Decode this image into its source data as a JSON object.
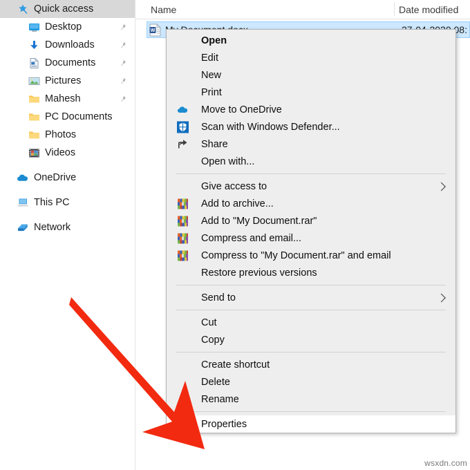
{
  "sidebar": {
    "items": [
      {
        "label": "Quick access",
        "icon": "star-pin-icon",
        "indent": 0,
        "selected": true,
        "pinned": false
      },
      {
        "label": "Desktop",
        "icon": "desktop-icon",
        "indent": 1,
        "selected": false,
        "pinned": true
      },
      {
        "label": "Downloads",
        "icon": "download-icon",
        "indent": 1,
        "selected": false,
        "pinned": true
      },
      {
        "label": "Documents",
        "icon": "documents-icon",
        "indent": 1,
        "selected": false,
        "pinned": true
      },
      {
        "label": "Pictures",
        "icon": "pictures-icon",
        "indent": 1,
        "selected": false,
        "pinned": true
      },
      {
        "label": "Mahesh",
        "icon": "folder-icon",
        "indent": 1,
        "selected": false,
        "pinned": true
      },
      {
        "label": "PC Documents",
        "icon": "folder-icon",
        "indent": 1,
        "selected": false,
        "pinned": false
      },
      {
        "label": "Photos",
        "icon": "folder-icon",
        "indent": 1,
        "selected": false,
        "pinned": false
      },
      {
        "label": "Videos",
        "icon": "videos-icon",
        "indent": 1,
        "selected": false,
        "pinned": false
      },
      {
        "label": "OneDrive",
        "icon": "onedrive-cloud-icon",
        "indent": 0,
        "selected": false,
        "pinned": false,
        "gap_before": true
      },
      {
        "label": "This PC",
        "icon": "this-pc-icon",
        "indent": 0,
        "selected": false,
        "pinned": false,
        "gap_before": true
      },
      {
        "label": "Network",
        "icon": "network-icon",
        "indent": 0,
        "selected": false,
        "pinned": false,
        "gap_before": true
      }
    ]
  },
  "file_list": {
    "columns": {
      "name": "Name",
      "date_modified": "Date modified"
    },
    "rows": [
      {
        "name": "My Document.docx",
        "date_modified": "27-04-2020 08:",
        "icon": "word-doc-icon",
        "selected": true
      }
    ]
  },
  "context_menu": {
    "items": [
      {
        "label": "Open",
        "icon": null,
        "bold": true,
        "submenu": false,
        "highlight": false
      },
      {
        "label": "Edit",
        "icon": null,
        "bold": false,
        "submenu": false,
        "highlight": false
      },
      {
        "label": "New",
        "icon": null,
        "bold": false,
        "submenu": false,
        "highlight": false
      },
      {
        "label": "Print",
        "icon": null,
        "bold": false,
        "submenu": false,
        "highlight": false
      },
      {
        "label": "Move to OneDrive",
        "icon": "onedrive-cloud-icon",
        "bold": false,
        "submenu": false,
        "highlight": false
      },
      {
        "label": "Scan with Windows Defender...",
        "icon": "shield-icon",
        "bold": false,
        "submenu": false,
        "highlight": false
      },
      {
        "label": "Share",
        "icon": "share-icon",
        "bold": false,
        "submenu": false,
        "highlight": false
      },
      {
        "label": "Open with...",
        "icon": null,
        "bold": false,
        "submenu": false,
        "highlight": false
      },
      {
        "separator": true
      },
      {
        "label": "Give access to",
        "icon": null,
        "bold": false,
        "submenu": true,
        "highlight": false
      },
      {
        "label": "Add to archive...",
        "icon": "winrar-icon",
        "bold": false,
        "submenu": false,
        "highlight": false
      },
      {
        "label": "Add to \"My Document.rar\"",
        "icon": "winrar-icon",
        "bold": false,
        "submenu": false,
        "highlight": false
      },
      {
        "label": "Compress and email...",
        "icon": "winrar-icon",
        "bold": false,
        "submenu": false,
        "highlight": false
      },
      {
        "label": "Compress to \"My Document.rar\" and email",
        "icon": "winrar-icon",
        "bold": false,
        "submenu": false,
        "highlight": false
      },
      {
        "label": "Restore previous versions",
        "icon": null,
        "bold": false,
        "submenu": false,
        "highlight": false
      },
      {
        "separator": true
      },
      {
        "label": "Send to",
        "icon": null,
        "bold": false,
        "submenu": true,
        "highlight": false
      },
      {
        "separator": true
      },
      {
        "label": "Cut",
        "icon": null,
        "bold": false,
        "submenu": false,
        "highlight": false
      },
      {
        "label": "Copy",
        "icon": null,
        "bold": false,
        "submenu": false,
        "highlight": false
      },
      {
        "separator": true
      },
      {
        "label": "Create shortcut",
        "icon": null,
        "bold": false,
        "submenu": false,
        "highlight": false
      },
      {
        "label": "Delete",
        "icon": null,
        "bold": false,
        "submenu": false,
        "highlight": false
      },
      {
        "label": "Rename",
        "icon": null,
        "bold": false,
        "submenu": false,
        "highlight": false
      },
      {
        "separator": true
      },
      {
        "label": "Properties",
        "icon": null,
        "bold": false,
        "submenu": false,
        "highlight": true
      }
    ]
  },
  "annotation": {
    "arrow": {
      "color": "#f22a10",
      "points_to": "Properties"
    }
  },
  "watermark": {
    "text": "wsxdn.com"
  },
  "colors": {
    "selection_blue": "#cde8ff",
    "menu_bg": "#eeeeee",
    "menu_highlight": "#ffffff",
    "nav_selected": "#d8d8d8",
    "arrow_red": "#f22a10",
    "accent_blue": "#0078d7"
  }
}
